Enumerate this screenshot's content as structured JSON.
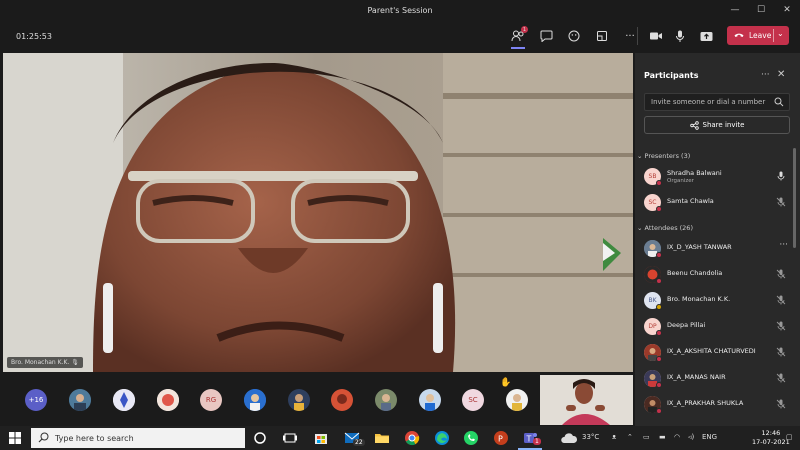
{
  "window": {
    "title": "Parent's Session",
    "timer": "01:25:53"
  },
  "toolbar": {
    "participants_badge": "1",
    "leave_label": "Leave"
  },
  "video": {
    "speaker_name": "Bro. Monachan K.K."
  },
  "strip": {
    "overflow_count": "+16",
    "avatars": [
      {
        "initials": "RG",
        "color": "#e9c7c2",
        "text_color": "#a33"
      },
      {
        "initials": "SC",
        "color": "#f0d8e0",
        "text_color": "#a33"
      }
    ]
  },
  "panel": {
    "title": "Participants",
    "invite_placeholder": "Invite someone or dial a number",
    "share_label": "Share invite",
    "presenters_header": "Presenters (3)",
    "attendees_header": "Attendees (26)",
    "presenters": [
      {
        "initials": "SB",
        "name": "Shradha Balwani",
        "role": "Organizer",
        "muted": false
      },
      {
        "initials": "SC",
        "name": "Samta Chawla",
        "role": "",
        "muted": true
      }
    ],
    "attendees": [
      {
        "initials": "",
        "name": "IX_D_YASH TANWAR",
        "photo": true
      },
      {
        "initials": "",
        "name": "Beenu Chandolia",
        "photo": true
      },
      {
        "initials": "BK",
        "name": "Bro. Monachan K.K.",
        "photo": false
      },
      {
        "initials": "DP",
        "name": "Deepa Pillai",
        "photo": false
      },
      {
        "initials": "",
        "name": "IX_A_AKSHITA CHATURVEDI",
        "photo": true
      },
      {
        "initials": "",
        "name": "IX_A_MANAS NAIR",
        "photo": true
      },
      {
        "initials": "",
        "name": "IX_A_PRAKHAR SHUKLA",
        "photo": true
      }
    ]
  },
  "taskbar": {
    "search_placeholder": "Type here to search",
    "mail_badge": "22",
    "teams_badge": "1",
    "temperature": "33°C",
    "language": "ENG",
    "time": "12:46",
    "date": "17-07-2021"
  },
  "colors": {
    "accent": "#7f85f5",
    "leave": "#c4314b",
    "panel": "#292929"
  }
}
